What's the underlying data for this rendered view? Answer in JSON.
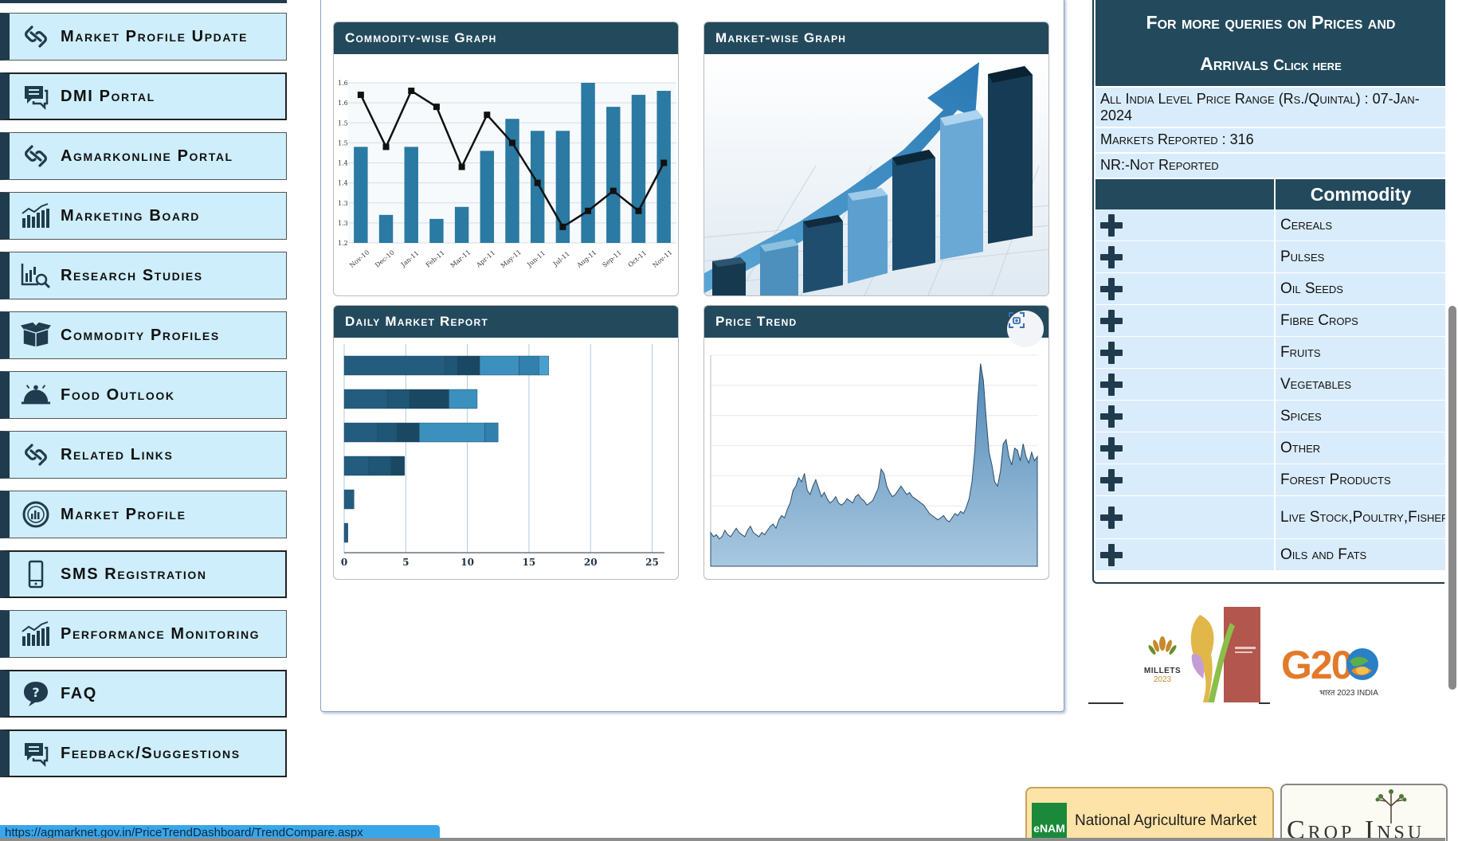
{
  "nav": {
    "items": [
      {
        "label": "Market Profile Update",
        "icon": "link-icon"
      },
      {
        "label": "DMI Portal",
        "icon": "chat-icon"
      },
      {
        "label": "Agmarkonline Portal",
        "icon": "link-icon"
      },
      {
        "label": "Marketing Board",
        "icon": "bar-chart-icon"
      },
      {
        "label": "Research Studies",
        "icon": "analytics-search-icon"
      },
      {
        "label": "Commodity Profiles",
        "icon": "box-icon"
      },
      {
        "label": "Food Outlook",
        "icon": "food-tray-icon"
      },
      {
        "label": "Related Links",
        "icon": "link-icon"
      },
      {
        "label": "Market Profile",
        "icon": "gauge-icon"
      },
      {
        "label": "SMS Registration",
        "icon": "mobile-icon"
      },
      {
        "label": "Performance Monitoring",
        "icon": "bar-chart-icon"
      },
      {
        "label": "FAQ",
        "icon": "question-chat-icon"
      },
      {
        "label": "Feedback/Suggestions",
        "icon": "chat-icon"
      }
    ]
  },
  "cards": {
    "commodity": {
      "title": "Commodity-wise Graph"
    },
    "market": {
      "title": "Market-wise Graph"
    },
    "daily": {
      "title": "Daily Market Report"
    },
    "price": {
      "title": "Price Trend"
    }
  },
  "chart_data": [
    {
      "type": "bar",
      "title": "Commodity-wise Graph",
      "categories": [
        "Nov-10",
        "Dec-10",
        "Jan-11",
        "Feb-11",
        "Mar-11",
        "Apr-11",
        "May-11",
        "Jun-11",
        "Jul-11",
        "Aug-11",
        "Sep-11",
        "Oct-11",
        "Nov-11"
      ],
      "y_ticks": [
        "1.2",
        "1.3",
        "1.3",
        "1.4",
        "1.4",
        "1.5",
        "1.5",
        "1.6",
        "1.6"
      ],
      "ylim": [
        1.2,
        1.6
      ],
      "series": [
        {
          "values": [
            1.44,
            1.27,
            1.44,
            1.26,
            1.29,
            1.43,
            1.51,
            1.48,
            1.48,
            1.6,
            1.54,
            1.57,
            1.58
          ]
        },
        {
          "values": [
            1.57,
            1.44,
            1.58,
            1.54,
            1.39,
            1.52,
            1.45,
            1.35,
            1.24,
            1.28,
            1.33,
            1.28,
            1.4
          ]
        }
      ]
    },
    {
      "type": "bar",
      "title": "Daily Market Report",
      "x_ticks": [
        "0",
        "5",
        "10",
        "15",
        "20",
        "25"
      ],
      "xlim": [
        0,
        26
      ],
      "rows": [
        [
          8.2,
          1.0,
          1.8,
          3.2,
          1.6,
          0.8
        ],
        [
          3.5,
          1.8,
          3.2,
          2.3
        ],
        [
          2.7,
          1.6,
          1.8,
          5.3,
          1.1
        ],
        [
          2.0,
          1.8,
          1.1
        ],
        [
          0.8
        ],
        [
          0.3
        ]
      ]
    },
    {
      "type": "area",
      "title": "Price Trend",
      "values": [
        16,
        14,
        15,
        13,
        14,
        17,
        15,
        14,
        16,
        18,
        16,
        15,
        14,
        17,
        19,
        16,
        15,
        14,
        16,
        15,
        17,
        19,
        20,
        18,
        22,
        24,
        23,
        27,
        30,
        36,
        38,
        42,
        40,
        44,
        36,
        34,
        38,
        41,
        37,
        33,
        35,
        32,
        30,
        31,
        33,
        30,
        29,
        30,
        32,
        31,
        30,
        33,
        34,
        32,
        31,
        29,
        30,
        31,
        34,
        37,
        46,
        44,
        38,
        35,
        33,
        34,
        36,
        38,
        36,
        34,
        35,
        33,
        32,
        31,
        30,
        29,
        27,
        25,
        24,
        23,
        22,
        23,
        24,
        22,
        21,
        23,
        25,
        24,
        26,
        25,
        28,
        32,
        40,
        55,
        78,
        96,
        88,
        70,
        54,
        48,
        40,
        38,
        45,
        58,
        60,
        52,
        48,
        56,
        55,
        50,
        58,
        52,
        49,
        54,
        50,
        52
      ]
    }
  ],
  "right": {
    "query_line1": "For more queries on Prices and",
    "query_line2": "Arrivals",
    "query_click": "Click here",
    "price_range": "All India Level Price Range (Rs./Quintal) : 07-Jan-2024",
    "markets_reported": "Markets Reported : 316",
    "nr_note": "NR:-Not Reported",
    "commodity_header": "Commodity",
    "commodities": [
      "Cereals",
      "Pulses",
      "Oil Seeds",
      "Fibre Crops",
      "Fruits",
      "Vegetables",
      "Spices",
      "Other",
      "Forest Products",
      "Live Stock,Poultry,Fisheries",
      "Oils and Fats"
    ]
  },
  "logos": {
    "millets": "MILLETS",
    "millets_year": "2023",
    "g20": "G20",
    "g20_caption": "भारत 2023 INDIA"
  },
  "banners": {
    "enam_logo": "eNAM",
    "enam_text": "National Agriculture Market",
    "crop_text": "Crop Insu"
  },
  "status_url": "https://agmarknet.gov.in/PriceTrendDashboard/TrendCompare.aspx",
  "colors": {
    "nav_bg": "#cdeefa",
    "header_dark": "#234a5c",
    "row_bg": "#d9ecfb",
    "bar_blue": "#2a7aa3"
  }
}
